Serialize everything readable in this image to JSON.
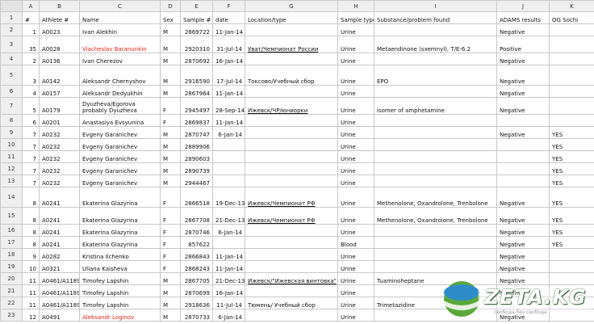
{
  "columns": [
    "A",
    "B",
    "C",
    "D",
    "E",
    "F",
    "G",
    "H",
    "I",
    "J",
    "K"
  ],
  "rows": [
    {
      "n": "1",
      "c": [
        "#",
        "Athlete #",
        "Name",
        "Sex",
        "Sample #",
        "date",
        "Location/type",
        "Sample type",
        "Substance/problem found",
        "ADAMS results",
        "OG Sochi"
      ]
    },
    {
      "n": "2",
      "c": [
        "1",
        "A0023",
        "Ivan Alekhin",
        "M",
        "2869722",
        "11-Jan-14",
        "",
        "Urine",
        "",
        "Negative",
        ""
      ]
    },
    {
      "n": "3",
      "c": [
        "35",
        "A0028",
        "Viacheslav Baranunkin",
        "M",
        "2920310",
        "31-Jul-14",
        "Уват/Чемпионат России",
        "Urine",
        "Metaendinone (sxemnyl), T/E-6.2",
        "Positive",
        ""
      ]
    },
    {
      "n": "4",
      "c": [
        "2",
        "A0136",
        "Ivan Cherezov",
        "M",
        "2870692",
        "16-Jan-14",
        "",
        "Urine",
        "",
        "Negative",
        ""
      ]
    },
    {
      "n": "5",
      "c": [
        "3",
        "A0142",
        "Aleksandr Chernyshov",
        "M",
        "2916590",
        "17-Jul-14",
        "Токсово/Учебный сбор",
        "Urine",
        "EPO",
        "Negative",
        ""
      ]
    },
    {
      "n": "6",
      "c": [
        "4",
        "A0157",
        "Aleksandr Dedyukhin",
        "M",
        "2867964",
        "11-Jan-14",
        "",
        "Urine",
        "",
        "Negative",
        ""
      ]
    },
    {
      "n": "7",
      "c": [
        "5",
        "A0179",
        "Dyuzheva/Egorova probably Dyuzheva",
        "F",
        "2945497",
        "28-Sep-14",
        "Ижевск/ЧР/юниорки",
        "Urine",
        "isomer of amphetamine",
        "Negative",
        ""
      ]
    },
    {
      "n": "8",
      "c": [
        "6",
        "A0201",
        "Anastasiya Evsyunina",
        "F",
        "2869837",
        "11-Jan-14",
        "",
        "Urine",
        "",
        "",
        ""
      ]
    },
    {
      "n": "9",
      "c": [
        "7",
        "A0232",
        "Evgeny Garanichev",
        "M",
        "2870747",
        "6-Jan-14",
        "",
        "Urine",
        "",
        "Negative",
        "YES"
      ]
    },
    {
      "n": "10",
      "c": [
        "7",
        "A0232",
        "Evgeny Garanichev",
        "M",
        "2889906",
        "",
        "",
        "Urine",
        "",
        "",
        "YES"
      ]
    },
    {
      "n": "11",
      "c": [
        "7",
        "A0232",
        "Evgeny Garanichev",
        "M",
        "2890603",
        "",
        "",
        "Urine",
        "",
        "",
        "YES"
      ]
    },
    {
      "n": "12",
      "c": [
        "7",
        "A0232",
        "Evgeny Garanichev",
        "M",
        "2890739",
        "",
        "",
        "Urine",
        "",
        "",
        "YES"
      ]
    },
    {
      "n": "13",
      "c": [
        "7",
        "A0232",
        "Evgeny Garanichev",
        "M",
        "2944467",
        "",
        "",
        "Urine",
        "",
        "",
        "YES"
      ]
    },
    {
      "n": "14",
      "c": [
        "8",
        "A0241",
        "Ekaterina Glazyrina",
        "F",
        "2866518",
        "19-Dec-13",
        "Ижевск/Чемпионат РФ",
        "Urine",
        "Methenolone, Oxandrolone, Trenbolone",
        "Negative",
        "YES"
      ]
    },
    {
      "n": "15",
      "c": [
        "8",
        "A0241",
        "Ekaterina Glazyrina",
        "F",
        "2867708",
        "21-Dec-13",
        "Ижевск/Чемпионат РФ",
        "Urine",
        "Methenolone, Oxandrolone, Trenbolone",
        "Negative",
        "YES"
      ]
    },
    {
      "n": "16",
      "c": [
        "8",
        "A0241",
        "Ekaterina Glazyrina",
        "F",
        "2870746",
        "6-Jan-14",
        "",
        "Urine",
        "",
        "Negative",
        "YES"
      ]
    },
    {
      "n": "17",
      "c": [
        "8",
        "A0241",
        "Ekaterina Glazyrina",
        "F",
        "857622",
        "",
        "",
        "Blood",
        "",
        "Negative",
        "YES"
      ]
    },
    {
      "n": "18",
      "c": [
        "9",
        "A0282",
        "Kristina Ilchenko",
        "F",
        "2866843",
        "11-Jan-14",
        "",
        "Urine",
        "",
        "Negative",
        ""
      ]
    },
    {
      "n": "19",
      "c": [
        "10",
        "A0321",
        "Uliana Kaisheva",
        "F",
        "2868243",
        "11-Jan-14",
        "",
        "Urine",
        "",
        "Negative",
        ""
      ]
    },
    {
      "n": "20",
      "c": [
        "11",
        "A0461/A1189",
        "Timofey Lapshin",
        "M",
        "2867705",
        "21-Dec-13",
        "Ижевск/\"Ижевская винтовка\"",
        "Urine",
        "Tuaminoheptane",
        "Negative",
        ""
      ]
    },
    {
      "n": "21",
      "c": [
        "11",
        "A0461/A1189",
        "Timofey Lapshin",
        "M",
        "2870699",
        "16-Jan-14",
        "",
        "Urine",
        "",
        "Negative",
        ""
      ]
    },
    {
      "n": "22",
      "c": [
        "11",
        "A0461/A1189",
        "Timofey Lapshin",
        "M",
        "2918636",
        "11-Jul-14",
        "Тюмень/ Учебный сбор",
        "Urine",
        "Trimetazidine",
        "",
        ""
      ]
    },
    {
      "n": "23",
      "c": [
        "12",
        "A0491",
        "Aleksandr Loginov",
        "M",
        "2870733",
        "6-Jan-14",
        "",
        "Urine",
        "",
        "Negative",
        ""
      ]
    }
  ],
  "watermark": {
    "brand": "ZETA.KG",
    "sub": "свобода без свобода"
  },
  "colors": {
    "header_bg": "#efefef",
    "grid": "#c8c8c8",
    "red_text": "#e0251b"
  }
}
